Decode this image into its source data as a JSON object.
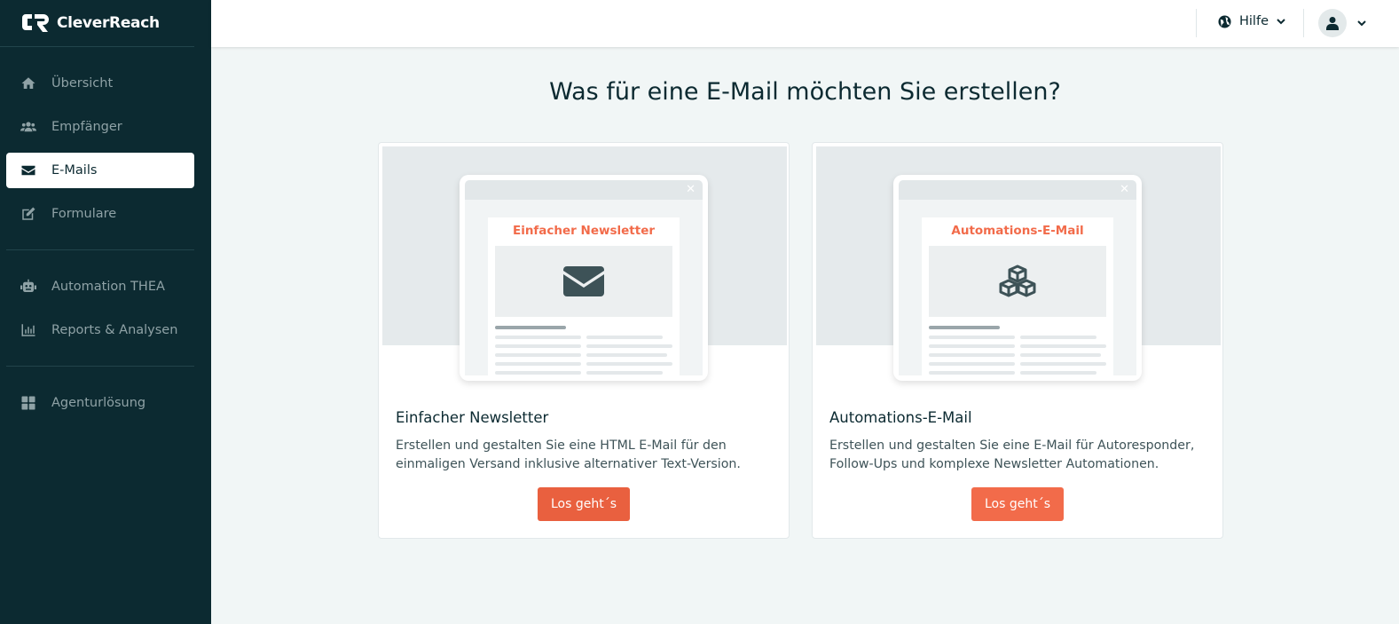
{
  "brand": {
    "name": "CleverReach"
  },
  "sidebar": {
    "groups": [
      [
        {
          "label": "Übersicht",
          "icon": "home-icon"
        },
        {
          "label": "Empfänger",
          "icon": "users-icon"
        },
        {
          "label": "E-Mails",
          "icon": "envelope-icon",
          "active": true
        },
        {
          "label": "Formulare",
          "icon": "edit-icon"
        }
      ],
      [
        {
          "label": "Automation THEA",
          "icon": "robot-icon"
        },
        {
          "label": "Reports & Analysen",
          "icon": "chart-icon"
        }
      ],
      [
        {
          "label": "Agenturlösung",
          "icon": "grid-icon"
        }
      ]
    ]
  },
  "topbar": {
    "help_label": "Hilfe",
    "help_icon": "globe-icon",
    "user_icon": "user-icon"
  },
  "main": {
    "heading": "Was für eine E-Mail möchten Sie erstellen?",
    "cards": [
      {
        "preview_title": "Einfacher Newsletter",
        "preview_icon": "envelope-icon",
        "title": "Einfacher Newsletter",
        "description": "Erstellen und gestalten Sie eine HTML E-Mail für den einmaligen Versand inklusive alternativer Text-Version.",
        "button": "Los geht´s"
      },
      {
        "preview_title": "Automations-E-Mail",
        "preview_icon": "cubes-icon",
        "title": "Automations-E-Mail",
        "description": "Erstellen und gestalten Sie eine E-Mail für Autoresponder, Follow-Ups und komplexe Newsletter Automationen.",
        "button": "Los geht´s"
      }
    ]
  },
  "colors": {
    "sidebar_bg": "#0c2a31",
    "accent": "#f26b4a",
    "page_bg": "#f1f6f6"
  }
}
